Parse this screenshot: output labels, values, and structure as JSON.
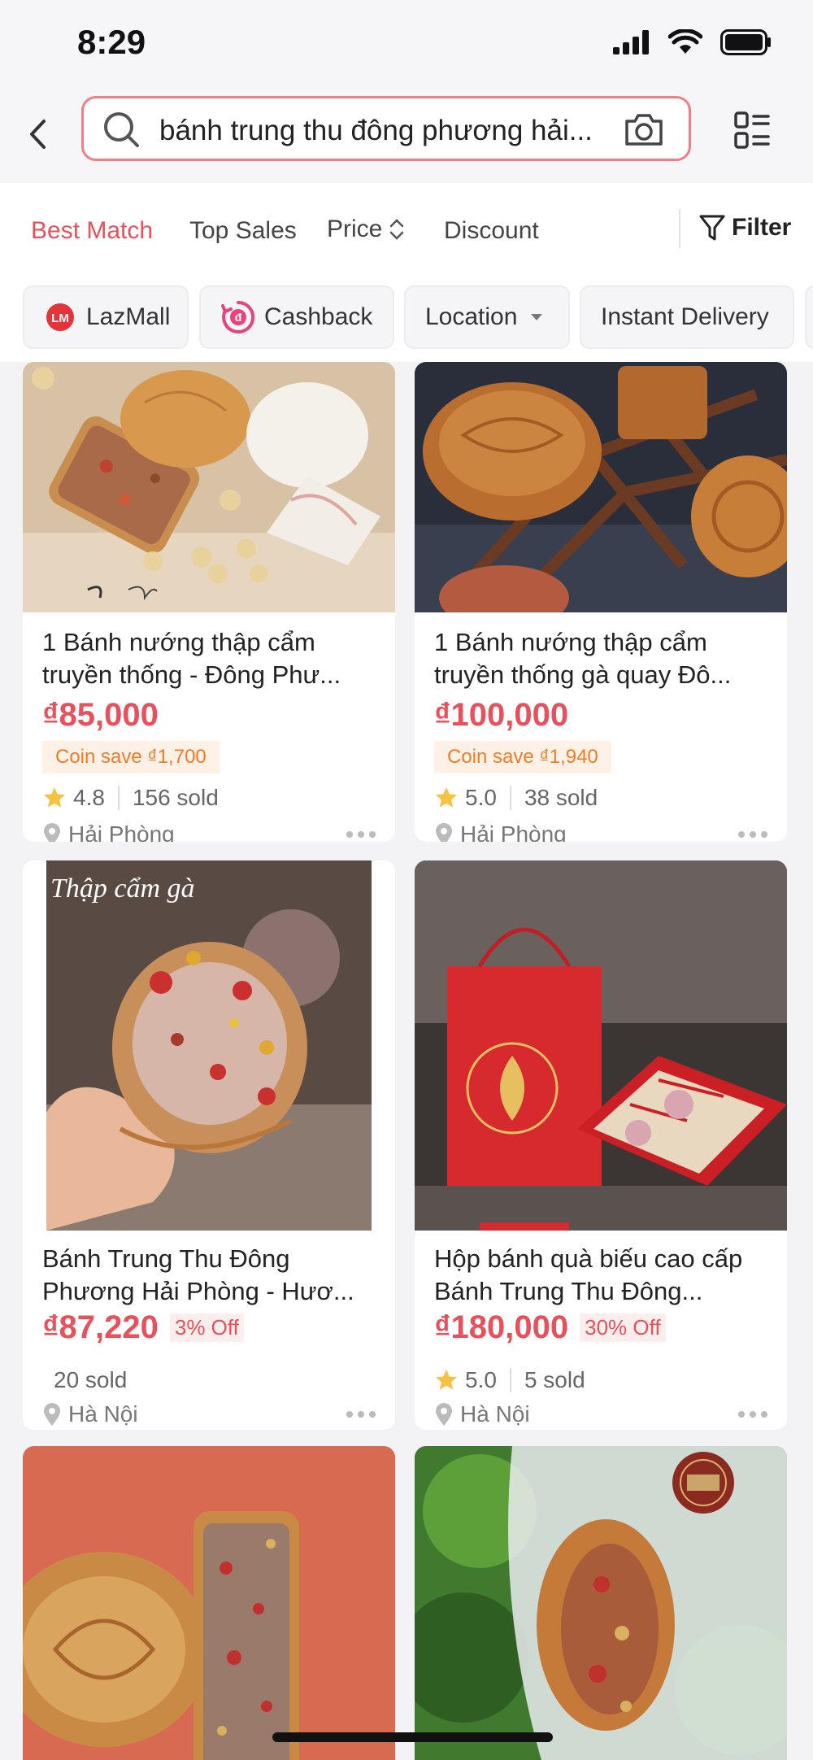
{
  "status": {
    "time": "8:29"
  },
  "search": {
    "query": "bánh trung thu đông phương hải..."
  },
  "sort": {
    "best_match": "Best Match",
    "top_sales": "Top Sales",
    "price": "Price",
    "discount": "Discount",
    "filter": "Filter"
  },
  "chips": {
    "lazmall": "LazMall",
    "cashback": "Cashback",
    "location": "Location",
    "instant_delivery": "Instant Delivery"
  },
  "products": [
    {
      "title": "1 Bánh nướng thập cẩm truyền thống -  Đông Phư...",
      "price": "₫85,000",
      "coin": "Coin save ₫1,700",
      "rating": "4.8",
      "sold": "156 sold",
      "location": "Hải Phòng"
    },
    {
      "title": "1 Bánh nướng thập cẩm truyền thống gà quay Đô...",
      "price": "₫100,000",
      "coin": "Coin save ₫1,940",
      "rating": "5.0",
      "sold": "38 sold",
      "location": "Hải Phòng"
    },
    {
      "title": "Bánh Trung Thu Đông Phương Hải Phòng - Hươ...",
      "price": "₫87,220",
      "discount": "3% Off",
      "sold": "20 sold",
      "location": "Hà Nội",
      "image_caption": "Thập cẩm gà"
    },
    {
      "title": "Hộp bánh quà biếu cao cấp Bánh Trung Thu Đông...",
      "price": "₫180,000",
      "discount": "30% Off",
      "rating": "5.0",
      "sold": "5 sold",
      "location": "Hà Nội"
    }
  ],
  "colors": {
    "accent": "#e8505b",
    "coin": "#f07c2a",
    "star": "#f5c242"
  }
}
